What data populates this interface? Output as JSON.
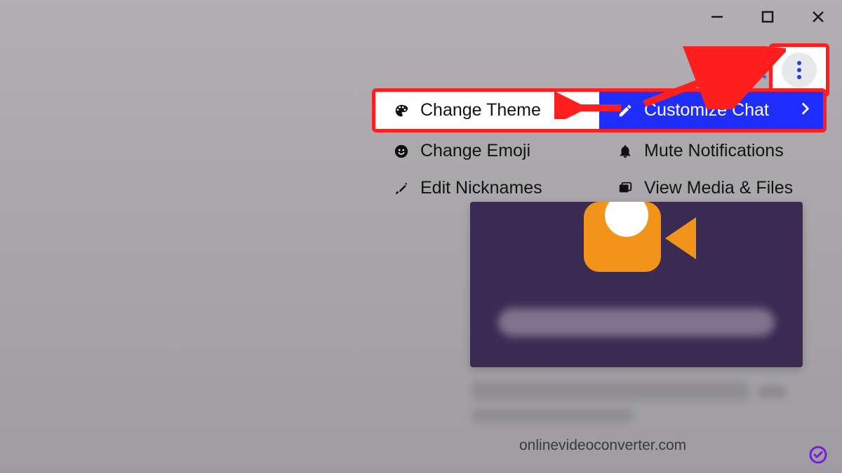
{
  "window_controls": {
    "minimize": "—",
    "maximize": "☐",
    "close": "✕"
  },
  "header": {
    "search_icon": "search",
    "more_icon": "more-vertical"
  },
  "menu": {
    "left": [
      {
        "icon": "palette",
        "label": "Change Theme"
      },
      {
        "icon": "emoji",
        "label": "Change Emoji"
      },
      {
        "icon": "pencil",
        "label": "Edit Nicknames"
      }
    ],
    "right": [
      {
        "icon": "edit",
        "label": "Customize Chat",
        "has_submenu": true,
        "active": true
      },
      {
        "icon": "bell",
        "label": "Mute Notifications"
      },
      {
        "icon": "media",
        "label": "View Media & Files"
      }
    ]
  },
  "link_url": "onlinevideoconverter.com",
  "colors": {
    "highlight_border": "#ff1e1e",
    "active_bg": "#1f2dff",
    "accent": "#7a1fd6"
  }
}
